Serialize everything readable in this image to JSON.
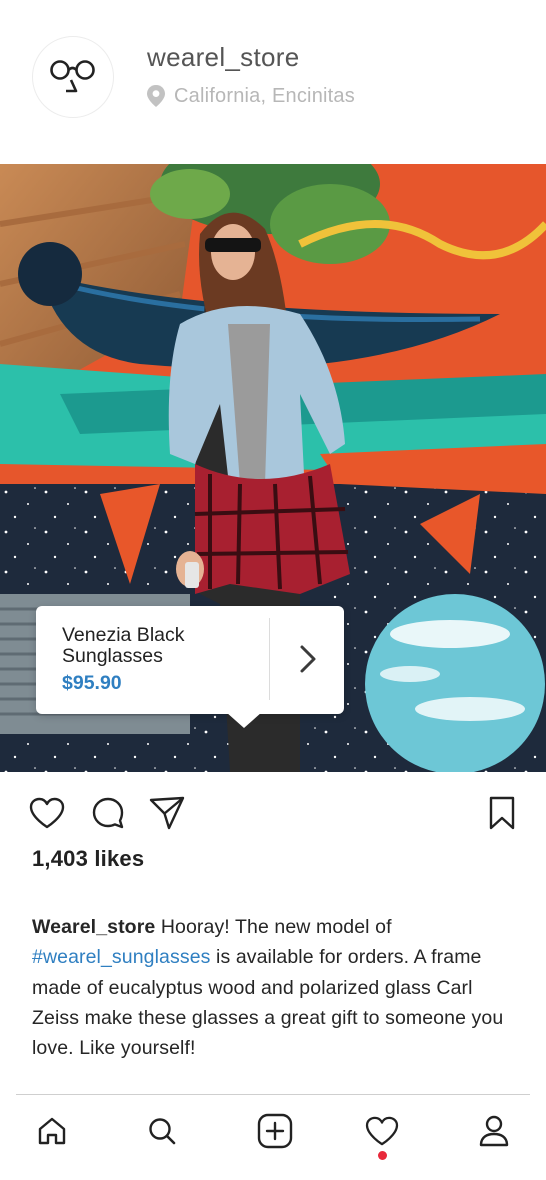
{
  "profile": {
    "username": "wearel_store",
    "location": "California, Encinitas",
    "avatar_icon": "glasses-logo-icon"
  },
  "post": {
    "image_description_icon": "street-mural-photo",
    "product_tag": {
      "name": "Venezia Black Sunglasses",
      "price": "$95.90",
      "arrow_icon": "chevron-right-icon"
    },
    "likes": "1,403 likes",
    "caption": {
      "author": "Wearel_store",
      "text_before": " Hooray! The new model of ",
      "hashtag": "#wearel_sunglasses",
      "text_after": " is available for orders. A frame made of eucalyptus wood and polarized glass Carl Zeiss make these glasses a great gift to someone you love. Like yourself!"
    }
  },
  "actions": {
    "like_icon": "heart-icon",
    "comment_icon": "comment-icon",
    "share_icon": "paper-plane-icon",
    "save_icon": "bookmark-icon"
  },
  "bottom_nav": {
    "items": [
      "home-icon",
      "search-icon",
      "add-post-icon",
      "heart-icon",
      "profile-icon"
    ],
    "notification_color": "#e8293b"
  },
  "colors": {
    "link": "#2f7fc1",
    "muted": "#b7b7b7"
  }
}
